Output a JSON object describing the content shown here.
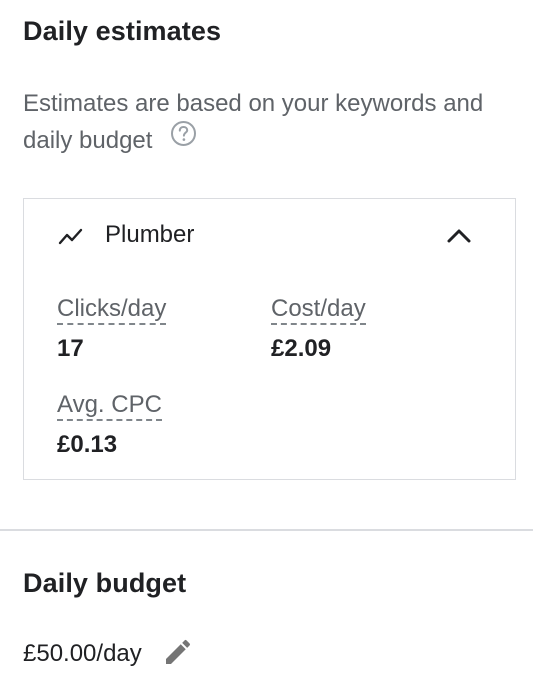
{
  "estimates": {
    "title": "Daily estimates",
    "description": "Estimates are based on your keywords and daily budget",
    "help_icon": "help-circle-icon"
  },
  "card": {
    "keyword": "Plumber",
    "trend_icon": "trending-icon",
    "collapse_icon": "chevron-up-icon",
    "metrics": {
      "clicks_label": "Clicks/day",
      "clicks_value": "17",
      "cost_label": "Cost/day",
      "cost_value": "£2.09",
      "cpc_label": "Avg. CPC",
      "cpc_value": "£0.13"
    }
  },
  "budget": {
    "title": "Daily budget",
    "value": "£50.00/day",
    "edit_icon": "pencil-icon"
  },
  "colors": {
    "text_primary": "#202124",
    "text_secondary": "#5f6368",
    "border": "#dadce0",
    "icon": "#757575"
  }
}
